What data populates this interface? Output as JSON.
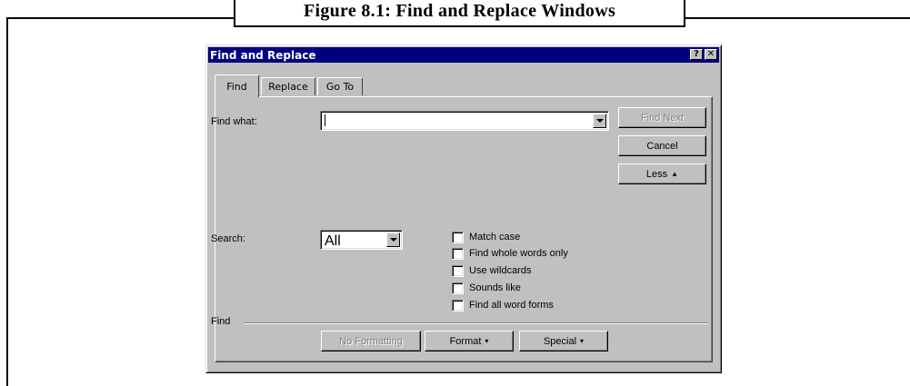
{
  "figure": {
    "caption": "Figure 8.1: Find and Replace Windows"
  },
  "dialog": {
    "title": "Find and Replace",
    "help_button": "?",
    "close_button": "✕",
    "tabs": [
      {
        "label": "Find",
        "active": true
      },
      {
        "label": "Replace",
        "active": false
      },
      {
        "label": "Go To",
        "active": false
      }
    ],
    "find_what_label": "Find what:",
    "find_what_value": "",
    "buttons": {
      "find_next": "Find Next",
      "cancel": "Cancel",
      "less": "Less",
      "less_icon": "▲"
    },
    "search_label": "Search:",
    "search_value": "All",
    "options": [
      {
        "label": "Match case",
        "checked": false
      },
      {
        "label": "Find whole words only",
        "checked": false
      },
      {
        "label": "Use wildcards",
        "checked": false
      },
      {
        "label": "Sounds like",
        "checked": false
      },
      {
        "label": "Find all word forms",
        "checked": false
      }
    ],
    "find_group_label": "Find",
    "bottom_buttons": {
      "no_formatting": "No Formatting",
      "format": "Format",
      "special": "Special",
      "menu_arrow": "▾"
    }
  }
}
